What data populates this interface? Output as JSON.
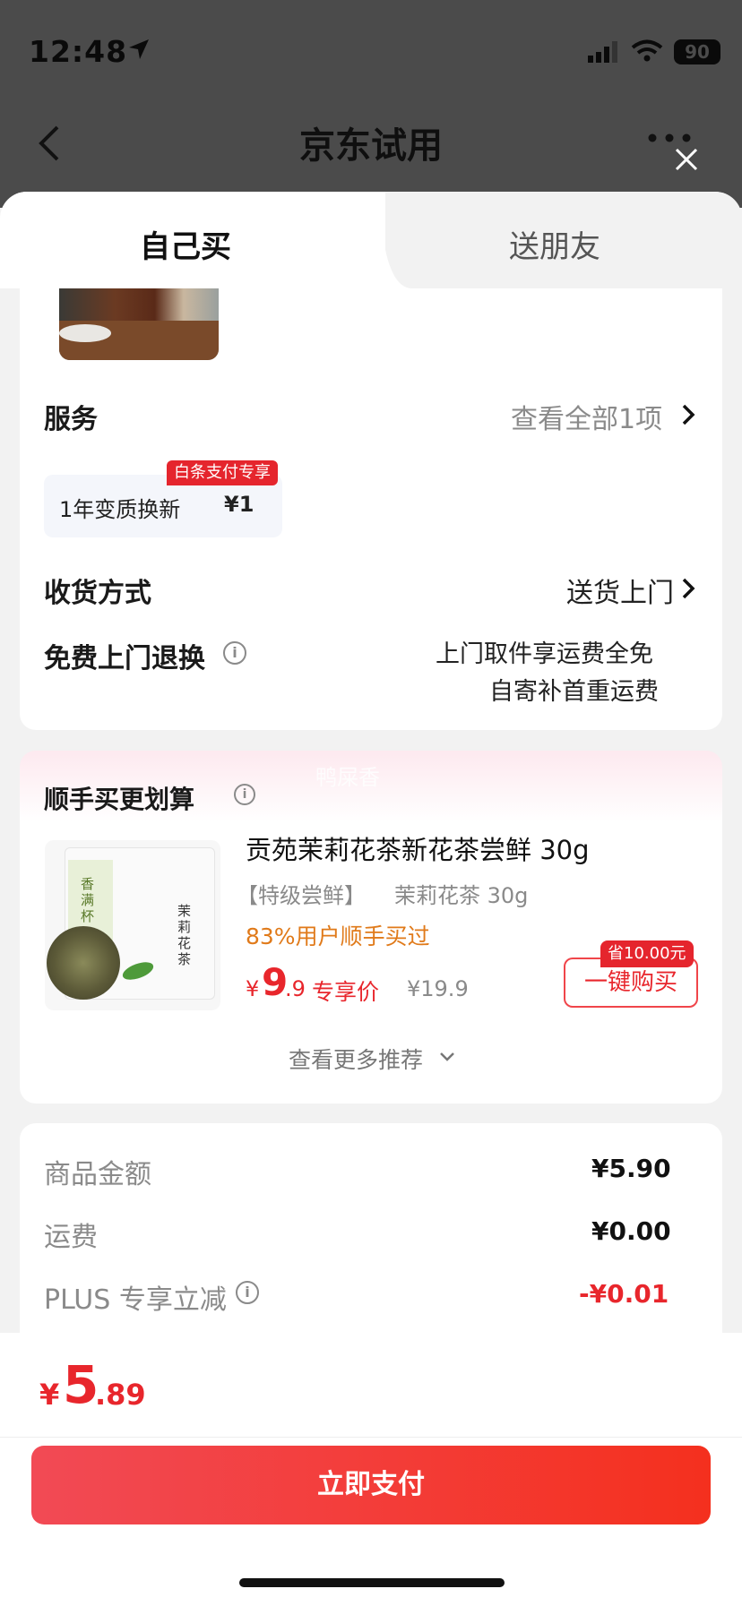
{
  "status_bar": {
    "time": "12:48",
    "battery": "90"
  },
  "nav": {
    "title": "京东试用"
  },
  "tabs": [
    {
      "label": "自己买"
    },
    {
      "label": "送朋友"
    }
  ],
  "service": {
    "label": "服务",
    "view_all": "查看全部1项",
    "item_name": "1年变质换新",
    "item_price": "¥1",
    "badge": "白条支付专享"
  },
  "delivery": {
    "label": "收货方式",
    "value": "送货上门"
  },
  "returns": {
    "label": "免费上门退换",
    "line1": "上门取件享运费全免",
    "line2": "自寄补首重运费"
  },
  "recommend": {
    "title": "顺手买更划算",
    "watermark": "鸭屎香",
    "product": {
      "name": "贡苑茉莉花茶新花茶尝鲜 30g",
      "spec_tag": "【特级尝鲜】",
      "spec": "茉莉花茶 30g",
      "stat": "83%用户顺手买过",
      "currency": "¥",
      "price_int": "9",
      "price_dec": ".9",
      "price_label": "专享价",
      "orig_price": "¥19.9",
      "save_tag": "省10.00元",
      "buy_label": "一键购买",
      "img_text1": "香满杯",
      "img_text2": "茉莉花茶"
    },
    "more": "查看更多推荐"
  },
  "summary": [
    {
      "label": "商品金额",
      "value": "¥5.90"
    },
    {
      "label": "运费",
      "value": "¥0.00"
    },
    {
      "label": "PLUS 专享立减",
      "value": "-¥0.01"
    }
  ],
  "total": {
    "currency": "¥",
    "int": "5",
    "dec": ".89"
  },
  "pay_label": "立即支付",
  "colors": {
    "accent": "#e8262c",
    "pay_start": "#f24a55",
    "pay_end": "#f4301e"
  }
}
